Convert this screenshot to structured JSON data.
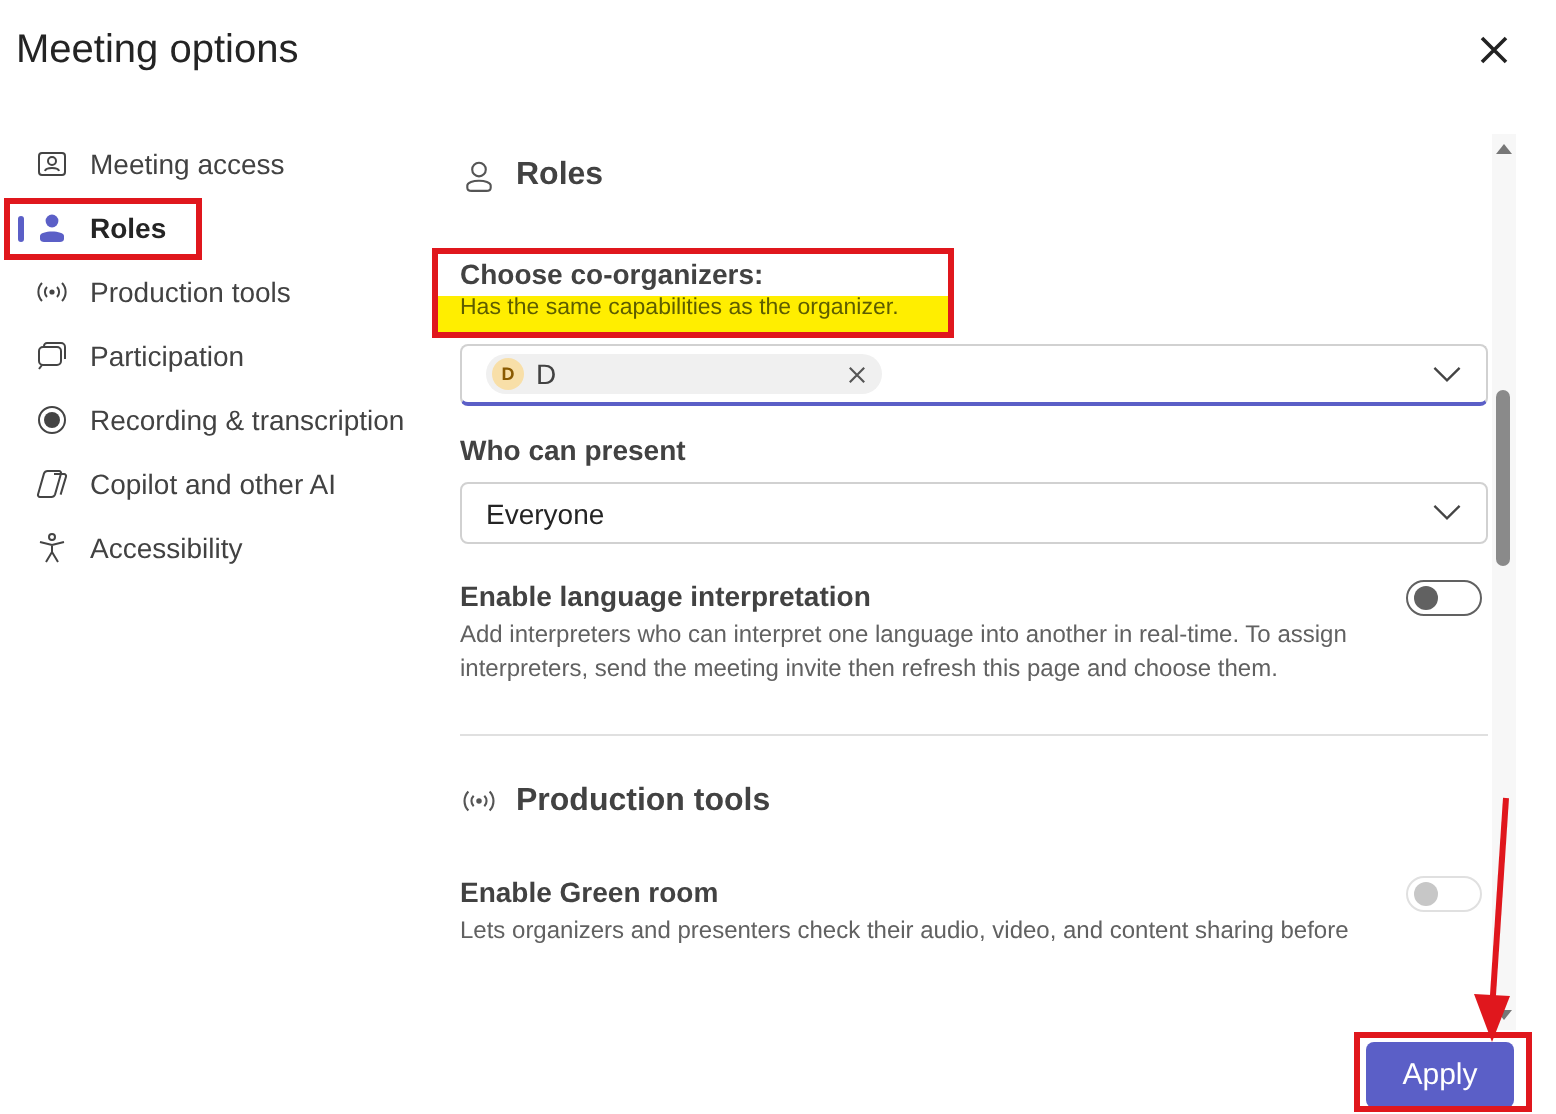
{
  "window": {
    "title": "Meeting options"
  },
  "sidebar": {
    "items": [
      {
        "label": "Meeting access",
        "kind": "access",
        "selected": false
      },
      {
        "label": "Roles",
        "kind": "roles",
        "selected": true
      },
      {
        "label": "Production tools",
        "kind": "production",
        "selected": false
      },
      {
        "label": "Participation",
        "kind": "participation",
        "selected": false
      },
      {
        "label": "Recording & transcription",
        "kind": "recording",
        "selected": false
      },
      {
        "label": "Copilot and other AI",
        "kind": "copilot",
        "selected": false
      },
      {
        "label": "Accessibility",
        "kind": "accessibility",
        "selected": false
      }
    ]
  },
  "sections": [
    {
      "kind": "roles",
      "title": "Roles",
      "items": [
        {
          "kind": "people",
          "label": "Choose co-organizers:",
          "description": "Has the same capabilities as the organizer.",
          "chips": [
            {
              "initial": "D",
              "name": "D"
            }
          ]
        },
        {
          "kind": "dropdown",
          "label": "Who can present",
          "value": "Everyone"
        },
        {
          "kind": "toggle",
          "label": "Enable language interpretation",
          "description": "Add interpreters who can interpret one language into another in real-time. To assign interpreters, send the meeting invite then refresh this page and choose them.",
          "on": false,
          "disabled": false
        }
      ]
    },
    {
      "kind": "production",
      "title": "Production tools",
      "items": [
        {
          "kind": "toggle",
          "label": "Enable Green room",
          "description": "Lets organizers and presenters check their audio, video, and content sharing before",
          "on": false,
          "disabled": true
        }
      ]
    }
  ],
  "apply_button": "Apply"
}
